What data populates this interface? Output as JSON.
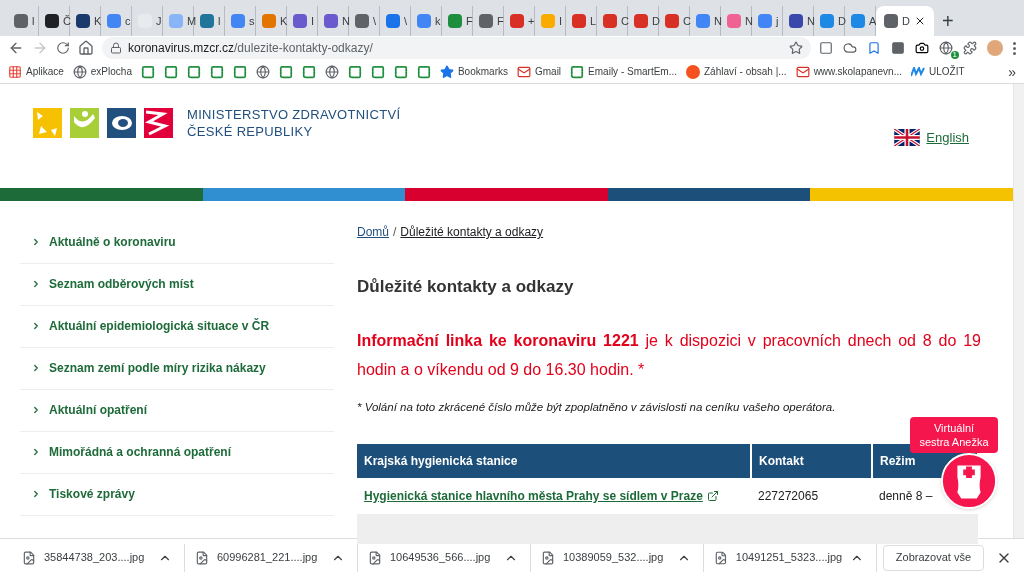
{
  "tabs": [
    {
      "title": "l",
      "color": "#5f6368",
      "selected": false
    },
    {
      "title": "Č",
      "color": "#202124",
      "selected": false
    },
    {
      "title": "K",
      "color": "#1a3a6b",
      "selected": false
    },
    {
      "title": "c",
      "color": "#4285f4",
      "selected": false
    },
    {
      "title": "J",
      "color": "#e8eaed",
      "selected": false
    },
    {
      "title": "M",
      "color": "#8ab4f8",
      "selected": false
    },
    {
      "title": "l",
      "color": "#21759b",
      "selected": false
    },
    {
      "title": "s",
      "color": "#4285f4",
      "selected": false
    },
    {
      "title": "K",
      "color": "#e37400",
      "selected": false
    },
    {
      "title": "I",
      "color": "#6a5acd",
      "selected": false
    },
    {
      "title": "N",
      "color": "#6a5acd",
      "selected": false
    },
    {
      "title": "\\",
      "color": "#5f6368",
      "selected": false
    },
    {
      "title": "\\",
      "color": "#1a73e8",
      "selected": false
    },
    {
      "title": "k",
      "color": "#4285f4",
      "selected": false
    },
    {
      "title": "F",
      "color": "#1e8e3e",
      "selected": false
    },
    {
      "title": "F",
      "color": "#5f6368",
      "selected": false
    },
    {
      "title": "+",
      "color": "#d93025",
      "selected": false
    },
    {
      "title": "I",
      "color": "#f9ab00",
      "selected": false
    },
    {
      "title": "L",
      "color": "#d93025",
      "selected": false
    },
    {
      "title": "C",
      "color": "#d93025",
      "selected": false
    },
    {
      "title": "D",
      "color": "#d93025",
      "selected": false
    },
    {
      "title": "C",
      "color": "#d93025",
      "selected": false
    },
    {
      "title": "N",
      "color": "#4285f4",
      "selected": false
    },
    {
      "title": "N",
      "color": "#f06292",
      "selected": false
    },
    {
      "title": "j",
      "color": "#4285f4",
      "selected": false
    },
    {
      "title": "N",
      "color": "#3949ab",
      "selected": false
    },
    {
      "title": "D",
      "color": "#1e88e5",
      "selected": false
    },
    {
      "title": "A",
      "color": "#1e88e5",
      "selected": false
    },
    {
      "title": "D",
      "color": "#5f6368",
      "selected": true
    }
  ],
  "new_tab": "+",
  "address": {
    "host": "koronavirus.mzcr.cz",
    "path": "/dulezite-kontakty-odkazy/"
  },
  "extension_badge": "1",
  "bookmarks": [
    {
      "kind": "apps",
      "label": "Aplikace"
    },
    {
      "kind": "globe",
      "label": "exPlocha"
    },
    {
      "kind": "square"
    },
    {
      "kind": "square"
    },
    {
      "kind": "square"
    },
    {
      "kind": "square"
    },
    {
      "kind": "square"
    },
    {
      "kind": "globe"
    },
    {
      "kind": "square"
    },
    {
      "kind": "square"
    },
    {
      "kind": "globe"
    },
    {
      "kind": "square"
    },
    {
      "kind": "square"
    },
    {
      "kind": "square"
    },
    {
      "kind": "square"
    },
    {
      "kind": "star",
      "label": "Bookmarks"
    },
    {
      "kind": "mail",
      "label": "Gmail"
    },
    {
      "kind": "square",
      "label": "Emaily - SmartEm..."
    },
    {
      "kind": "orange",
      "label": "Záhlaví - obsah |..."
    },
    {
      "kind": "mail",
      "label": "www.skolapanevn..."
    },
    {
      "kind": "wave",
      "label": "ULOŽIT"
    }
  ],
  "bookmarks_more": "»",
  "site": {
    "title_line_1": "MINISTERSTVO ZDRAVOTNICTVÍ",
    "title_line_2": "ČESKÉ REPUBLIKY",
    "language": "English"
  },
  "stripes": [
    {
      "color": "#1e6b3a"
    },
    {
      "color": "#2f8fd0"
    },
    {
      "color": "#d8002f"
    },
    {
      "color": "#1c4f7a"
    },
    {
      "color": "#f4c200"
    }
  ],
  "sidebar": [
    "Aktuálně o koronaviru",
    "Seznam odběrových míst",
    "Aktuální epidemiologická situace v ČR",
    "Seznam zemí podle míry rizika nákazy",
    "Aktuální opatření",
    "Mimořádná a ochranná opatření",
    "Tiskové zprávy"
  ],
  "breadcrumb": {
    "home": "Domů",
    "separator": "/",
    "current": "Důležité kontakty a odkazy"
  },
  "heading": "Důležité kontakty a odkazy",
  "info": "**Informační linka ke koronaviru 1221** je k dispozici v pracovních dnech od 8 do 19 hodin a o víkendu od 9 do 16.30 hodin. *",
  "footnote": "* Volání na toto zkrácené číslo může být zpoplatněno v závislosti na ceníku vašeho operátora.",
  "table": {
    "columns": [
      "Krajská hygienická stanice",
      "Kontakt",
      "Režim"
    ],
    "rows": [
      {
        "station": "Hygienická stanice hlavního města Prahy se sídlem v Praze",
        "contact": "227272065",
        "mode": "denně 8 –"
      }
    ]
  },
  "assistant": {
    "line_1": "Virtuální",
    "line_2": "sestra Anežka"
  },
  "downloads": [
    "35844738_203....jpg",
    "60996281_221....jpg",
    "10649536_566....jpg",
    "10389059_532....jpg",
    "10491251_5323....jpg"
  ],
  "show_all": "Zobrazovat vše"
}
